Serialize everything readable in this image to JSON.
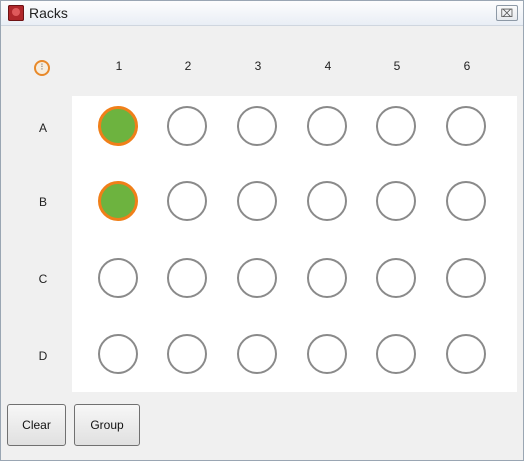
{
  "window": {
    "title": "Racks",
    "close_glyph": "⌧"
  },
  "grid": {
    "corner_icon": "rack-settings-icon",
    "columns": [
      "1",
      "2",
      "3",
      "4",
      "5",
      "6"
    ],
    "rows": [
      "A",
      "B",
      "C",
      "D"
    ],
    "selected_wells": [
      "A1",
      "B1"
    ],
    "colors": {
      "selected_fill": "#6db33f",
      "selected_border": "#f07f19",
      "empty_border": "#8a8a8a"
    }
  },
  "buttons": {
    "clear_label": "Clear",
    "group_label": "Group"
  }
}
